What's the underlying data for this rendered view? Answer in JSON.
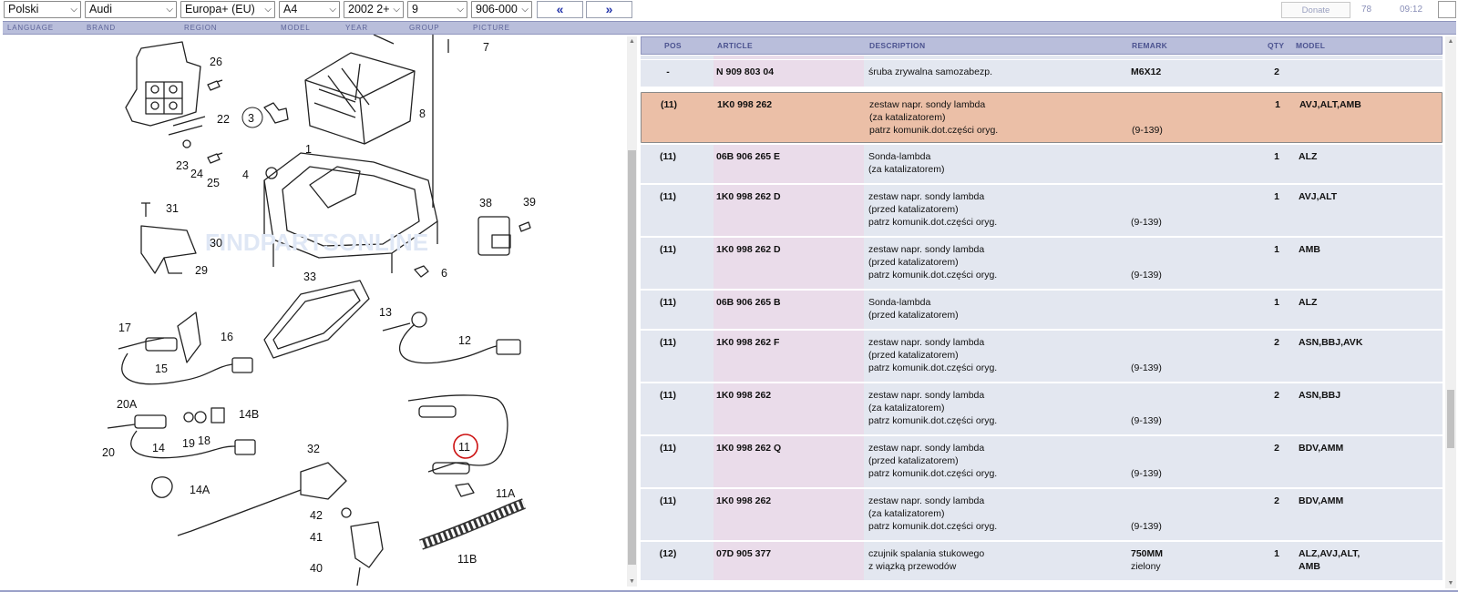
{
  "toolbar": {
    "language": "Polski",
    "brand": "Audi",
    "region": "Europa+ (EU)",
    "model": "A4",
    "year": "2002  2+",
    "group": "9",
    "picture": "906-000",
    "prev": "«",
    "next": "»",
    "donate": "Donate",
    "count": "78",
    "time": "09:12"
  },
  "labels": {
    "language": "LANGUAGE",
    "brand": "BRAND",
    "region": "REGION",
    "model": "MODEL",
    "year": "YEAR",
    "group": "GROUP",
    "picture": "PICTURE"
  },
  "table": {
    "headers": {
      "pos": "POS",
      "article": "ARTICLE",
      "description": "DESCRIPTION",
      "remark": "REMARK",
      "qty": "QTY",
      "model": "MODEL"
    },
    "rows": [
      {
        "pos": "-",
        "article": "N   909 803 04",
        "d1": "śruba zrywalna samozabezp.",
        "d2": "",
        "d3": "",
        "remark": "M6X12",
        "remark2": "",
        "qty": "2",
        "model": "",
        "model2": ""
      },
      {
        "pos": "(11)",
        "article": "1K0 998 262",
        "d1": "zestaw napr. sondy lambda",
        "d2": "(za katalizatorem)",
        "d3": "patrz komunik.dot.części oryg.",
        "remark": "",
        "remark2": "(9-139)",
        "qty": "1",
        "model": "AVJ,ALT,AMB",
        "model2": ""
      },
      {
        "pos": "(11)",
        "article": "06B 906 265 E",
        "d1": "Sonda-lambda",
        "d2": "(za katalizatorem)",
        "d3": "",
        "remark": "",
        "remark2": "",
        "qty": "1",
        "model": "ALZ",
        "model2": ""
      },
      {
        "pos": "(11)",
        "article": "1K0 998 262 D",
        "d1": "zestaw napr. sondy lambda",
        "d2": "(przed katalizatorem)",
        "d3": "patrz komunik.dot.części oryg.",
        "remark": "",
        "remark2": "(9-139)",
        "qty": "1",
        "model": "AVJ,ALT",
        "model2": ""
      },
      {
        "pos": "(11)",
        "article": "1K0 998 262 D",
        "d1": "zestaw napr. sondy lambda",
        "d2": "(przed katalizatorem)",
        "d3": "patrz komunik.dot.części oryg.",
        "remark": "",
        "remark2": "(9-139)",
        "qty": "1",
        "model": "AMB",
        "model2": ""
      },
      {
        "pos": "(11)",
        "article": "06B 906 265 B",
        "d1": "Sonda-lambda",
        "d2": "(przed katalizatorem)",
        "d3": "",
        "remark": "",
        "remark2": "",
        "qty": "1",
        "model": "ALZ",
        "model2": ""
      },
      {
        "pos": "(11)",
        "article": "1K0 998 262 F",
        "d1": "zestaw napr. sondy lambda",
        "d2": "(przed katalizatorem)",
        "d3": "patrz komunik.dot.części oryg.",
        "remark": "",
        "remark2": "(9-139)",
        "qty": "2",
        "model": "ASN,BBJ,AVK",
        "model2": ""
      },
      {
        "pos": "(11)",
        "article": "1K0 998 262",
        "d1": "zestaw napr. sondy lambda",
        "d2": "(za katalizatorem)",
        "d3": "patrz komunik.dot.części oryg.",
        "remark": "",
        "remark2": "(9-139)",
        "qty": "2",
        "model": "ASN,BBJ",
        "model2": ""
      },
      {
        "pos": "(11)",
        "article": "1K0 998 262 Q",
        "d1": "zestaw napr. sondy lambda",
        "d2": "(przed katalizatorem)",
        "d3": "patrz komunik.dot.części oryg.",
        "remark": "",
        "remark2": "(9-139)",
        "qty": "2",
        "model": "BDV,AMM",
        "model2": ""
      },
      {
        "pos": "(11)",
        "article": "1K0 998 262",
        "d1": "zestaw napr. sondy lambda",
        "d2": "(za katalizatorem)",
        "d3": "patrz komunik.dot.części oryg.",
        "remark": "",
        "remark2": "(9-139)",
        "qty": "2",
        "model": "BDV,AMM",
        "model2": ""
      },
      {
        "pos": "(12)",
        "article": "07D 905 377",
        "d1": "czujnik spalania stukowego",
        "d2": "z wiązką przewodów",
        "d3": "",
        "remark": "750MM",
        "remark2": "zielony",
        "qty": "1",
        "model": "ALZ,AVJ,ALT,",
        "model2": "AMB"
      }
    ]
  },
  "diagram": {
    "watermark": "FINDPARTSONLINE",
    "callouts": [
      "26",
      "22",
      "3",
      "23",
      "24",
      "25",
      "8",
      "7",
      "1",
      "4",
      "31",
      "30",
      "29",
      "38",
      "39",
      "33",
      "6",
      "13",
      "17",
      "16",
      "12",
      "15",
      "20A",
      "14B",
      "20",
      "14",
      "19",
      "18",
      "11",
      "32",
      "14A",
      "11A",
      "42",
      "41",
      "11B",
      "40"
    ],
    "highlighted": "11"
  },
  "selected_row": 1,
  "colors": {
    "header_bg": "#b9bedb",
    "row_bg": "#e3e7f0",
    "article_bg": "#eadcea",
    "selected_bg": "#ebbfa7",
    "highlight_ring": "#cc1111"
  }
}
